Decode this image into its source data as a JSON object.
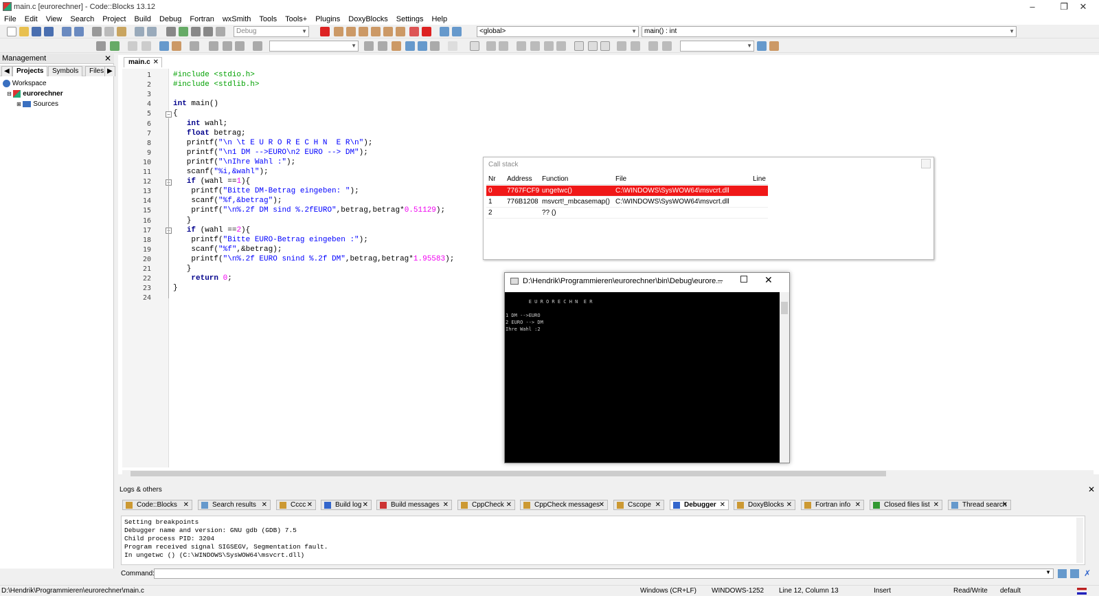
{
  "window": {
    "title": "main.c [eurorechner] - Code::Blocks 13.12"
  },
  "menu": [
    "File",
    "Edit",
    "View",
    "Search",
    "Project",
    "Build",
    "Debug",
    "Fortran",
    "wxSmith",
    "Tools",
    "Tools+",
    "Plugins",
    "DoxyBlocks",
    "Settings",
    "Help"
  ],
  "toolbar": {
    "build_target": "Debug",
    "scope": "<global>",
    "symbol": "main() : int"
  },
  "management": {
    "title": "Management",
    "tabs": [
      "Projects",
      "Symbols",
      "Files"
    ],
    "tree": {
      "workspace": "Workspace",
      "project": "eurorechner",
      "folder": "Sources"
    }
  },
  "editor": {
    "file_tab": "main.c",
    "line_numbers": [
      "1",
      "2",
      "3",
      "4",
      "5",
      "6",
      "7",
      "8",
      "9",
      "10",
      "11",
      "12",
      "13",
      "14",
      "15",
      "16",
      "17",
      "18",
      "19",
      "20",
      "21",
      "22",
      "23",
      "24"
    ],
    "lines": [
      "#include <stdio.h>",
      "#include <stdlib.h>",
      "",
      "int main()",
      "{",
      "   int wahl;",
      "   float betrag;",
      "   printf(\"\\n \\t E U R O R E C H N  E R\\n\");",
      "   printf(\"\\n1 DM -->EURO\\n2 EURO --> DM\");",
      "   printf(\"\\nIhre Wahl :\");",
      "   scanf(\"%i,&wahl\");",
      "   if (wahl ==1){",
      "    printf(\"Bitte DM-Betrag eingeben: \");",
      "    scanf(\"%f,&betrag\");",
      "    printf(\"\\n%.2f DM sind %.2fEURO\",betrag,betrag*0.51129);",
      "   }",
      "   if (wahl ==2){",
      "    printf(\"Bitte EURO-Betrag eingeben :\");",
      "    scanf(\"%f\",&betrag);",
      "    printf(\"\\n%.2f EURO snind %.2f DM\",betrag,betrag*1.95583);",
      "   }",
      "    return 0;",
      "}",
      ""
    ]
  },
  "callstack": {
    "title": "Call stack",
    "columns": [
      "Nr",
      "Address",
      "Function",
      "File",
      "Line"
    ],
    "rows": [
      {
        "nr": "0",
        "address": "7767FCF9",
        "function": "ungetwc()",
        "file": "C:\\WINDOWS\\SysWOW64\\msvcrt.dll",
        "line": ""
      },
      {
        "nr": "1",
        "address": "776B1208",
        "function": "msvcrt!_mbcasemap()",
        "file": "C:\\WINDOWS\\SysWOW64\\msvcrt.dll",
        "line": ""
      },
      {
        "nr": "2",
        "address": "",
        "function": "?? ()",
        "file": "",
        "line": ""
      }
    ]
  },
  "console": {
    "title": "D:\\Hendrik\\Programmieren\\eurorechner\\bin\\Debug\\eurore...",
    "lines": [
      "        E U R O R E C H N  E R",
      "",
      "1 DM -->EURO",
      "2 EURO --> DM",
      "Ihre Wahl :2"
    ]
  },
  "logs": {
    "title": "Logs & others",
    "tabs": [
      "Code::Blocks",
      "Search results",
      "Cccc",
      "Build log",
      "Build messages",
      "CppCheck",
      "CppCheck messages",
      "Cscope",
      "Debugger",
      "DoxyBlocks",
      "Fortran info",
      "Closed files list",
      "Thread search"
    ],
    "active_tab": "Debugger",
    "lines": [
      "Setting breakpoints",
      "Debugger name and version: GNU gdb (GDB) 7.5",
      "Child process PID: 3204",
      "Program received signal SIGSEGV, Segmentation fault.",
      "In ungetwc () (C:\\WINDOWS\\SysWOW64\\msvcrt.dll)"
    ],
    "command_label": "Command:"
  },
  "status": {
    "path": "D:\\Hendrik\\Programmieren\\eurorechner\\main.c",
    "eol": "Windows (CR+LF)",
    "encoding": "WINDOWS-1252",
    "position": "Line 12, Column 13",
    "mode": "Insert",
    "access": "Read/Write",
    "profile": "default"
  },
  "colors": {
    "selected_row": "#f01818",
    "keyword": "#00008b",
    "preproc": "#00a000",
    "string": "#0000ff",
    "number": "#f000f0"
  }
}
